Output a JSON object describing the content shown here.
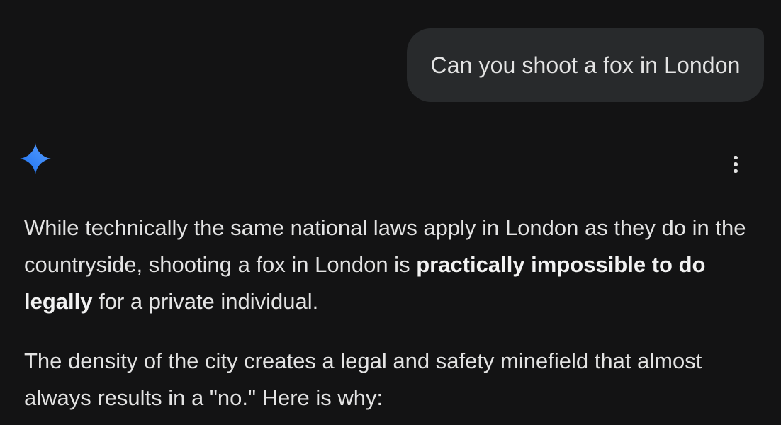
{
  "user_message": {
    "text": "Can you shoot a fox in London"
  },
  "assistant": {
    "logo_icon": "gemini-sparkle-icon",
    "menu_icon": "more-vert-icon",
    "paragraphs": [
      {
        "before": "While technically the same national laws apply in London as they do in the countryside, shooting a fox in London is ",
        "bold": "practically impossible to do legally",
        "after": " for a private individual."
      },
      {
        "text": "The density of the city creates a legal and safety minefield that almost always results in a \"no.\" Here is why:"
      }
    ]
  },
  "colors": {
    "background": "#131314",
    "user_bubble": "#282a2c",
    "text": "#e3e3e3",
    "sparkle_gradient": [
      "#4285f4",
      "#1a73e8"
    ]
  }
}
